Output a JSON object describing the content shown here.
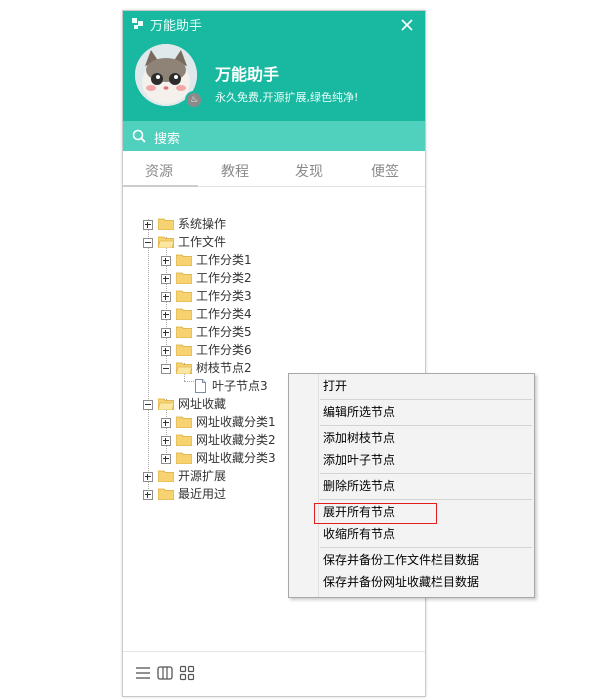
{
  "app": {
    "window_title": "万能助手",
    "user_name": "万能助手",
    "motto": "永久免费,开源扩展,绿色纯净!",
    "search_label": "搜索",
    "accent_color": "#19b8a0",
    "search_bar_color": "#4fd1bd"
  },
  "tabs": [
    {
      "label": "资源",
      "active": true
    },
    {
      "label": "教程",
      "active": false
    },
    {
      "label": "发现",
      "active": false
    },
    {
      "label": "便签",
      "active": false
    }
  ],
  "tree": {
    "n0": {
      "label": "系统操作",
      "expanded": false
    },
    "n1": {
      "label": "工作文件",
      "expanded": true
    },
    "n2": {
      "label": "工作分类1",
      "expanded": false
    },
    "n3": {
      "label": "工作分类2",
      "expanded": false
    },
    "n4": {
      "label": "工作分类3",
      "expanded": false
    },
    "n5": {
      "label": "工作分类4",
      "expanded": false
    },
    "n6": {
      "label": "工作分类5",
      "expanded": false
    },
    "n7": {
      "label": "工作分类6",
      "expanded": false
    },
    "n8": {
      "label": "树枝节点2",
      "expanded": true
    },
    "n9": {
      "label": "叶子节点3",
      "leaf": true
    },
    "n10": {
      "label": "网址收藏",
      "expanded": true
    },
    "n11": {
      "label": "网址收藏分类1",
      "expanded": false
    },
    "n12": {
      "label": "网址收藏分类2",
      "expanded": false
    },
    "n13": {
      "label": "网址收藏分类3",
      "expanded": false
    },
    "n14": {
      "label": "开源扩展",
      "expanded": false
    },
    "n15": {
      "label": "最近用过",
      "expanded": false
    }
  },
  "context_menu": {
    "open": "打开",
    "edit_selected": "编辑所选节点",
    "add_branch": "添加树枝节点",
    "add_leaf": "添加叶子节点",
    "delete_selected": "删除所选节点",
    "expand_all": "展开所有节点",
    "collapse_all": "收缩所有节点",
    "save_backup_work": "保存并备份工作文件栏目数据",
    "save_backup_url": "保存并备份网址收藏栏目数据",
    "highlighted_item": "展开所有节点"
  },
  "footer": {
    "icons": [
      "menu-icon",
      "layout-icon",
      "grid-icon"
    ]
  }
}
